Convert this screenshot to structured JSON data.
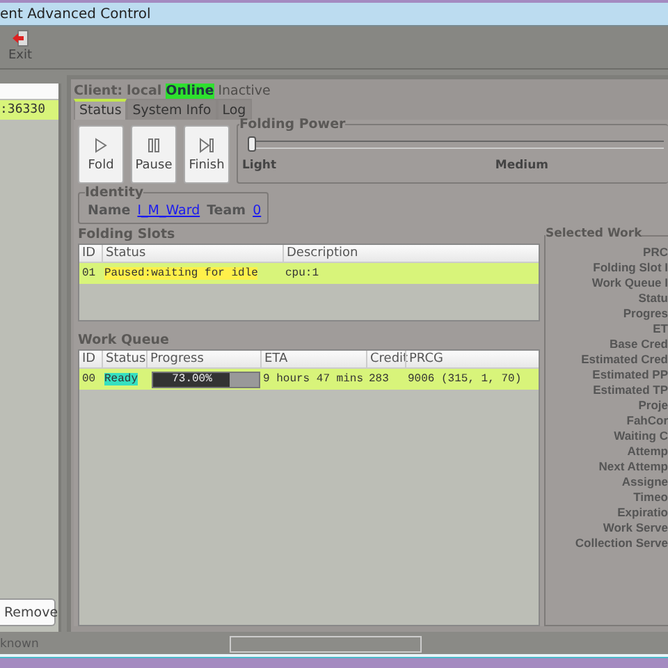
{
  "window": {
    "title": "ent Advanced Control"
  },
  "toolbar": [
    {
      "label": "Exit",
      "kind": "exit"
    }
  ],
  "clients": {
    "rows": [
      {
        "text": ":36330",
        "selected": true
      }
    ],
    "remove_label": "Remove"
  },
  "client_status": {
    "label": "Client:",
    "name": "local",
    "states": [
      {
        "label": "Online",
        "active": true
      },
      {
        "label": "Inactive",
        "active": false
      }
    ]
  },
  "tabs": [
    {
      "label": "Status",
      "selected": true
    },
    {
      "label": "System Info",
      "selected": false
    },
    {
      "label": "Log",
      "selected": false
    }
  ],
  "controls": [
    {
      "label": "Fold",
      "kind": "play"
    },
    {
      "label": "Pause",
      "kind": "pause"
    },
    {
      "label": "Finish",
      "kind": "finish"
    }
  ],
  "folding_power": {
    "title": "Folding Power",
    "level": 0,
    "labels": [
      "Light",
      "Medium"
    ]
  },
  "identity": {
    "title": "Identity",
    "name_label": "Name",
    "name": "I_M_Ward",
    "team_label": "Team",
    "team": "0"
  },
  "folding_slots": {
    "title": "Folding Slots",
    "columns": [
      "ID",
      "Status",
      "Description"
    ],
    "rows": [
      {
        "id": "01",
        "status": {
          "text": "Paused:waiting for idle",
          "color": "#fff04a"
        },
        "description": "cpu:1",
        "selected": true
      }
    ]
  },
  "work_queue": {
    "title": "Work Queue",
    "columns": [
      "ID",
      "Status",
      "Progress",
      "ETA",
      "Credit",
      "PRCG"
    ],
    "rows": [
      {
        "id": "00",
        "status": {
          "text": "Ready",
          "color": "#36e0c0"
        },
        "progress": "73.00%",
        "level": 0.73,
        "eta": "9 hours 47 mins",
        "credit": "283",
        "prcg": "9006 (315, 1, 70)",
        "selected": true
      }
    ]
  },
  "selected_work_unit": {
    "title": "Selected Work",
    "fields": [
      "PRC",
      "Folding Slot I",
      "Work Queue I",
      "Statu",
      "Progres",
      "ET",
      "Base Cred",
      "Estimated Cred",
      "Estimated PP",
      "Estimated TP",
      "Proje",
      "FahCor",
      "Waiting C",
      "Attemp",
      "Next Attemp",
      "Assigne",
      "Timeo",
      "Expiratio",
      "Work Serve",
      "Collection Serve"
    ]
  },
  "status_bar": {
    "text": "known"
  }
}
